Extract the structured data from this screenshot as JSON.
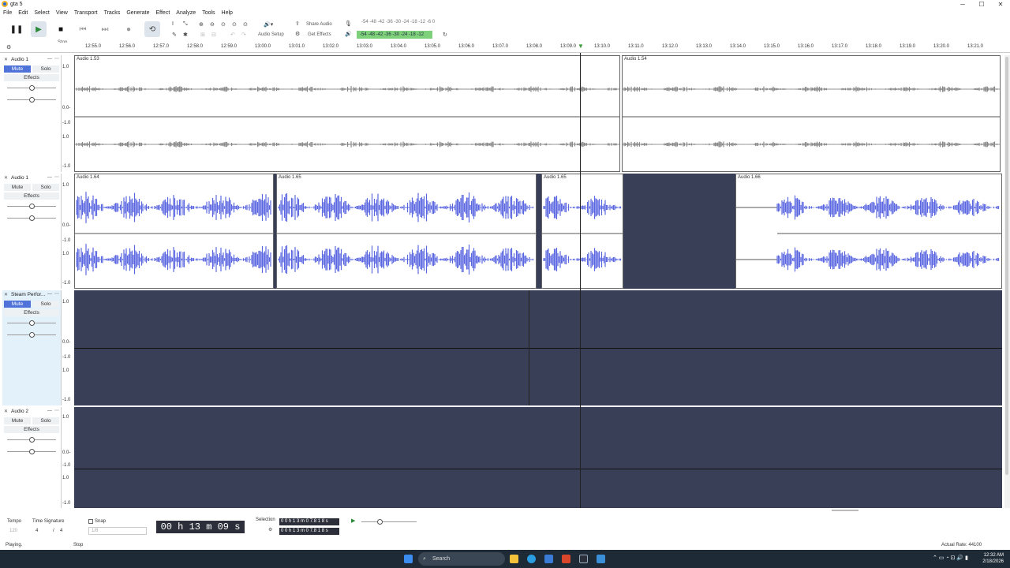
{
  "window": {
    "title": "gta 5"
  },
  "menu": [
    "File",
    "Edit",
    "Select",
    "View",
    "Transport",
    "Tracks",
    "Generate",
    "Effect",
    "Analyze",
    "Tools",
    "Help"
  ],
  "toolbar": {
    "share_audio": "Share Audio",
    "audio_setup": "Audio Setup",
    "get_effects": "Get Effects",
    "tooltip": "Stop",
    "meter_top": "-54 -48 -42 -36 -30 -24 -18 -12 -6 0",
    "meter_bottom": "-54 -48 -42 -36 -30 -24 -18 -12"
  },
  "ruler": {
    "ticks": [
      "12:55.0",
      "12:56.0",
      "12:57.0",
      "12:58.0",
      "12:59.0",
      "13:00.0",
      "13:01.0",
      "13:02.0",
      "13:03.0",
      "13:04.0",
      "13:05.0",
      "13:06.0",
      "13:07.0",
      "13:08.0",
      "13:09.0",
      "13:10.0",
      "13:11.0",
      "13:12.0",
      "13:13.0",
      "13:14.0",
      "13:15.0",
      "13:16.0",
      "13:17.0",
      "13:18.0",
      "13:19.0",
      "13:20.0",
      "13:21.0"
    ]
  },
  "scale_labels": [
    "1.0",
    "0.5",
    "0.0-",
    "-0.5",
    "-1.0"
  ],
  "tracks": [
    {
      "name": "Audio 1",
      "mute": "Mute",
      "solo": "Solo",
      "effects": "Effects",
      "clips": [
        "Audio 1.53",
        "Audio 1.54"
      ]
    },
    {
      "name": "Audio 1",
      "mute": "Mute",
      "solo": "Solo",
      "effects": "Effects",
      "clips": [
        "Audio 1.64",
        "Audio 1.65",
        "Audio 1.65",
        "Audio 1.66"
      ]
    },
    {
      "name": "Steam Perfor...",
      "mute": "Mute",
      "solo": "Solo",
      "effects": "Effects",
      "clips": []
    },
    {
      "name": "Audio 2",
      "mute": "Mute",
      "solo": "Solo",
      "effects": "Effects",
      "clips": []
    }
  ],
  "bottom": {
    "tempo_label": "Tempo",
    "tempo_value": "120",
    "timesig_label": "Time Signature",
    "timesig_num": "4",
    "timesig_den": "4",
    "snap_label": "Snap",
    "snap_value": "1/8",
    "time": "00 h 13 m 09 s",
    "selection_label": "Selection",
    "sel_start": "0 0 h 1 3 m 0 7.8 1 8 s",
    "sel_end": "0 0 h 1 3 m 0 7.8 1 8 s"
  },
  "status": {
    "left": "Playing.",
    "middle": "Stop",
    "right": "Actual Rate: 44100"
  },
  "taskbar": {
    "search": "Search",
    "time": "12:32 AM",
    "date": "2/18/2026"
  }
}
